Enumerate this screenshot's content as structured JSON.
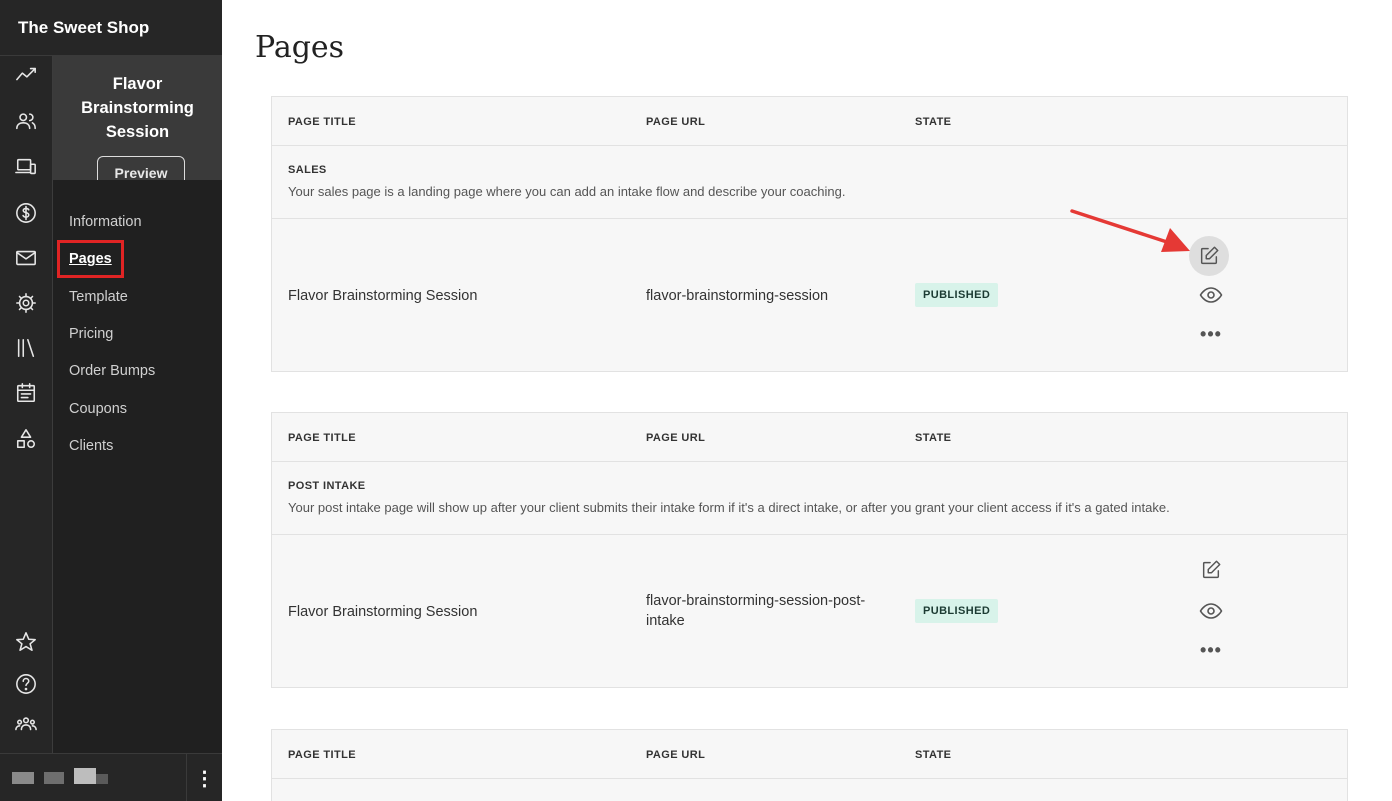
{
  "brand": "The Sweet Shop",
  "rail": [
    "activity-icon",
    "people-icon",
    "devices-icon",
    "dollar-icon",
    "mail-icon",
    "settings-icon",
    "library-icon",
    "calendar-icon",
    "shapes-icon",
    "star-icon",
    "help-icon",
    "community-icon"
  ],
  "course": {
    "title": "Flavor Brainstorming Session",
    "preview_label": "Preview"
  },
  "nav": [
    {
      "label": "Information"
    },
    {
      "label": "Pages"
    },
    {
      "label": "Template"
    },
    {
      "label": "Pricing"
    },
    {
      "label": "Order Bumps"
    },
    {
      "label": "Coupons"
    },
    {
      "label": "Clients"
    }
  ],
  "main": {
    "title": "Pages"
  },
  "columns": {
    "title": "PAGE TITLE",
    "url": "PAGE URL",
    "state": "STATE"
  },
  "panels": [
    {
      "name": "SALES",
      "description": "Your sales page is a landing page where you can add an intake flow and describe your coaching.",
      "page_title": "Flavor Brainstorming Session",
      "page_url": "flavor-brainstorming-session",
      "state": "PUBLISHED"
    },
    {
      "name": "POST INTAKE",
      "description": "Your post intake page will show up after your client submits their intake form if it's a direct intake, or after you grant your client access if it's a gated intake.",
      "page_title": "Flavor Brainstorming Session",
      "page_url_1": "flavor-brainstorming-session-post-",
      "page_url_2": "intake",
      "state": "PUBLISHED"
    }
  ],
  "actions": {
    "more": "•••"
  },
  "accent": {
    "published_bg": "#d8f3ea",
    "highlight": "#e02424",
    "sidebar": "#262626"
  }
}
